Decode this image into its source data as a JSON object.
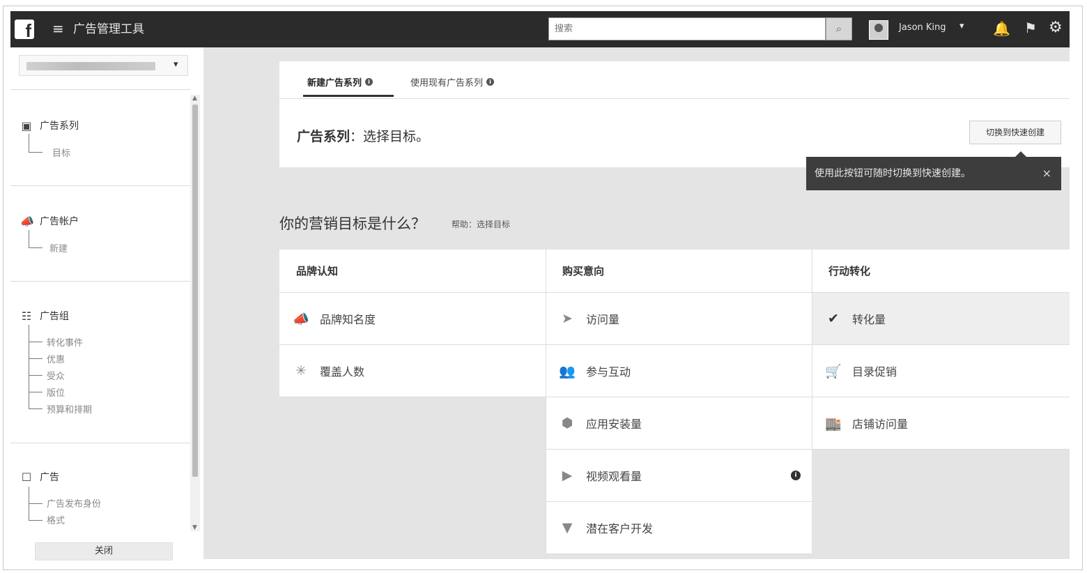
{
  "topbar": {
    "logo": "f",
    "menu_icon": "≡",
    "title": "广告管理工具",
    "search_placeholder": "搜索",
    "search_icon": "⌕",
    "user_name": "Jason King",
    "user_caret": "▾",
    "bell_icon": "🔔",
    "flag_icon": "⚑",
    "gear_icon": "⚙"
  },
  "sidebar": {
    "account_caret": "▾",
    "sections": [
      {
        "title": "广告系列",
        "icon": "▣",
        "items": [
          "目标"
        ]
      },
      {
        "title": "广告帐户",
        "icon": "📣",
        "items": [
          "新建"
        ]
      },
      {
        "title": "广告组",
        "icon": "☷",
        "items": [
          "转化事件",
          "优惠",
          "受众",
          "版位",
          "预算和排期"
        ]
      },
      {
        "title": "广告",
        "icon": "☐",
        "items": [
          "广告发布身份",
          "格式"
        ]
      }
    ],
    "close_label": "关闭"
  },
  "tabs": [
    {
      "label": "新建广告系列",
      "active": true
    },
    {
      "label": "使用现有广告系列",
      "active": false
    }
  ],
  "tab_info_icon": "i",
  "campaign_label_bold": "广告系列",
  "campaign_label_rest": "：选择目标。",
  "quick_create_button": "切换到快速创建",
  "tooltip": {
    "text": "使用此按钮可随时切换到快速创建。",
    "close": "×"
  },
  "goal_question": "你的营销目标是什么？",
  "goal_help": "帮助：选择目标",
  "columns": [
    {
      "header": "品牌认知",
      "objectives": [
        {
          "label": "品牌知名度",
          "icon": "📣"
        },
        {
          "label": "覆盖人数",
          "icon": "✳"
        }
      ]
    },
    {
      "header": "购买意向",
      "objectives": [
        {
          "label": "访问量",
          "icon": "➤"
        },
        {
          "label": "参与互动",
          "icon": "👥"
        },
        {
          "label": "应用安装量",
          "icon": "⬢"
        },
        {
          "label": "视频观看量",
          "icon": "▶"
        },
        {
          "label": "潜在客户开发",
          "icon": "▼"
        }
      ]
    },
    {
      "header": "行动转化",
      "objectives": [
        {
          "label": "转化量",
          "icon": "✔",
          "selected": true
        },
        {
          "label": "目录促销",
          "icon": "🛒"
        },
        {
          "label": "店铺访问量",
          "icon": "🏬"
        }
      ]
    }
  ]
}
